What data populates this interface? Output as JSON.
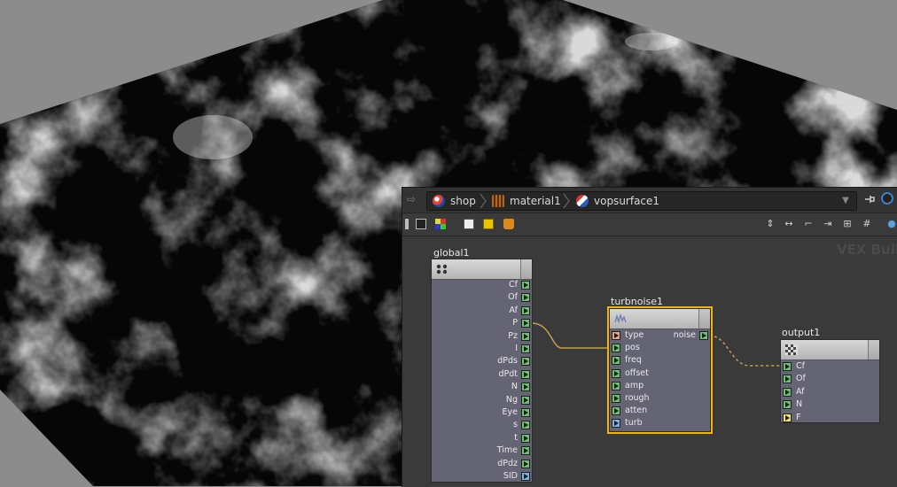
{
  "path_bar": {
    "crumbs": [
      {
        "label": "shop",
        "icon": "shop-icon"
      },
      {
        "label": "material1",
        "icon": "material-icon"
      },
      {
        "label": "vopsurface1",
        "icon": "vopsurface-icon"
      }
    ]
  },
  "network": {
    "watermark": "VEX Buil",
    "nodes": {
      "global": {
        "name": "global1",
        "outputs": [
          "Cf",
          "Of",
          "Af",
          "P",
          "Pz",
          "I",
          "dPds",
          "dPdt",
          "N",
          "Ng",
          "Eye",
          "s",
          "t",
          "Time",
          "dPdz",
          "SID"
        ],
        "output_colors": [
          "#6cc270",
          "#6cc270",
          "#6cc270",
          "#6cc270",
          "#6cc270",
          "#6cc270",
          "#6cc270",
          "#6cc270",
          "#6cc270",
          "#6cc270",
          "#6cc270",
          "#6cc270",
          "#6cc270",
          "#6cc270",
          "#6cc270",
          "#78b4e6"
        ]
      },
      "turbnoise": {
        "name": "turbnoise1",
        "inputs": [
          "type",
          "pos",
          "freq",
          "offset",
          "amp",
          "rough",
          "atten",
          "turb"
        ],
        "input_colors": [
          "#e6a58c",
          "#6cc270",
          "#6cc270",
          "#6cc270",
          "#6cc270",
          "#6cc270",
          "#6cc270",
          "#78b4e6"
        ],
        "output": "noise"
      },
      "output": {
        "name": "output1",
        "inputs": [
          "Cf",
          "Of",
          "Af",
          "N",
          "F"
        ],
        "input_colors": [
          "#6cc270",
          "#6cc270",
          "#6cc270",
          "#6cc270",
          "#f5e66c"
        ]
      }
    }
  },
  "colors": {
    "selection": "#f5b400",
    "wire": "#c8a048",
    "node_body": "#656475"
  }
}
